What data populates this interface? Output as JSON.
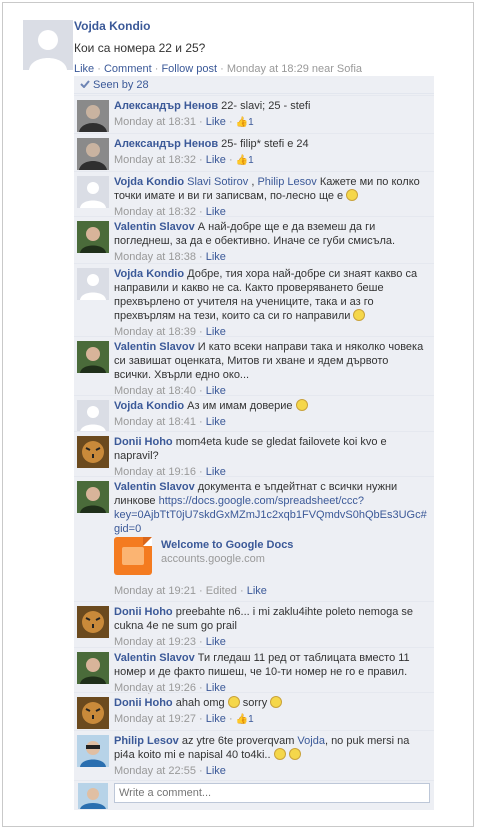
{
  "post": {
    "author": "Vojda Kondio",
    "text": "Кои са номера 22 и 25?",
    "actions": {
      "like": "Like",
      "comment": "Comment",
      "follow": "Follow post"
    },
    "time": "Monday at 18:29 near Sofia"
  },
  "seen_by": "Seen by 28",
  "comments": [
    {
      "author": "Александър Ненов",
      "text": "22- slavi; 25 - stefi",
      "time": "Monday at 18:31",
      "like": "Like",
      "likes": "1",
      "avatar": "photo-dark"
    },
    {
      "author": "Александър Ненов",
      "text": "25- filip* stefi e 24",
      "time": "Monday at 18:32",
      "like": "Like",
      "likes": "1",
      "avatar": "photo-dark"
    },
    {
      "author": "Vojda Kondio",
      "mentions": [
        "Slavi Sotirov",
        "Philip Lesov"
      ],
      "text": "Кажете ми по колко точки имате и ви ги записвам, по-лесно ще е",
      "time": "Monday at 18:32",
      "like": "Like",
      "avatar": "silhouette"
    },
    {
      "author": "Valentin Slavov",
      "text": "А най-добре ще е да вземеш да ги погледнеш, за да е обективно. Иначе се губи смисъла.",
      "time": "Monday at 18:38",
      "like": "Like",
      "avatar": "photo-green"
    },
    {
      "author": "Vojda Kondio",
      "text": "Добре, тия хора най-добре си знаят какво са направили и какво не са. Както проверяването беше прехвърлено от учителя на учениците, така и аз го прехвърлям на тези, които са си го направили",
      "time": "Monday at 18:39",
      "like": "Like",
      "avatar": "silhouette"
    },
    {
      "author": "Valentin Slavov",
      "text": "И като всеки направи така и няколко човека си завишат оценката, Митов ги хване и ядем дървото всички. Хвърли едно око...",
      "time": "Monday at 18:40",
      "like": "Like",
      "avatar": "photo-green"
    },
    {
      "author": "Vojda Kondio",
      "text": "Аз им имам доверие",
      "time": "Monday at 18:41",
      "like": "Like",
      "avatar": "silhouette"
    },
    {
      "author": "Donii Hoho",
      "text": "mom4eta kude se gledat failovete koi kvo e napravil?",
      "time": "Monday at 19:16",
      "like": "Like",
      "avatar": "photo-tiger"
    },
    {
      "author": "Valentin Slavov",
      "text": "документа е ъпдейтнат с всички нужни линкове",
      "url": "https://docs.google.com/spreadsheet/ccc?key=0AjbTtT0jU7skdGxMZmJ1c2xqb1FVQmdvS0hQbEs3UGc#gid=0",
      "attachment": {
        "title": "Welcome to Google Docs",
        "domain": "accounts.google.com"
      },
      "time": "Monday at 19:21",
      "edited": "Edited",
      "like": "Like",
      "avatar": "photo-green"
    },
    {
      "author": "Donii Hoho",
      "text": "preebahte n6... i mi zaklu4ihte poleto nemoga se cukna 4e ne sum go prail",
      "time": "Monday at 19:23",
      "like": "Like",
      "avatar": "photo-tiger"
    },
    {
      "author": "Valentin Slavov",
      "text": "Ти гледаш 11 ред от таблицата вместо 11 номер и де факто пишеш, че 10-ти номер не го е правил.",
      "time": "Monday at 19:26",
      "like": "Like",
      "avatar": "photo-green"
    },
    {
      "author": "Donii Hoho",
      "text": "ahah omg",
      "text2": "sorry",
      "time": "Monday at 19:27",
      "like": "Like",
      "likes": "1",
      "avatar": "photo-tiger"
    },
    {
      "author": "Philip Lesov",
      "text": "az ytre 6te proverqvam",
      "mention": "Vojda",
      "text2": ", no puk mersi na pi4a koito mi e napisal 40 to4ki..",
      "time": "Monday at 22:55",
      "like": "Like",
      "avatar": "photo-blue"
    }
  ],
  "write_comment": {
    "placeholder": "Write a comment..."
  },
  "colors": {
    "link": "#3b5998",
    "meta": "#999999",
    "comments_bg": "#edeff4"
  }
}
